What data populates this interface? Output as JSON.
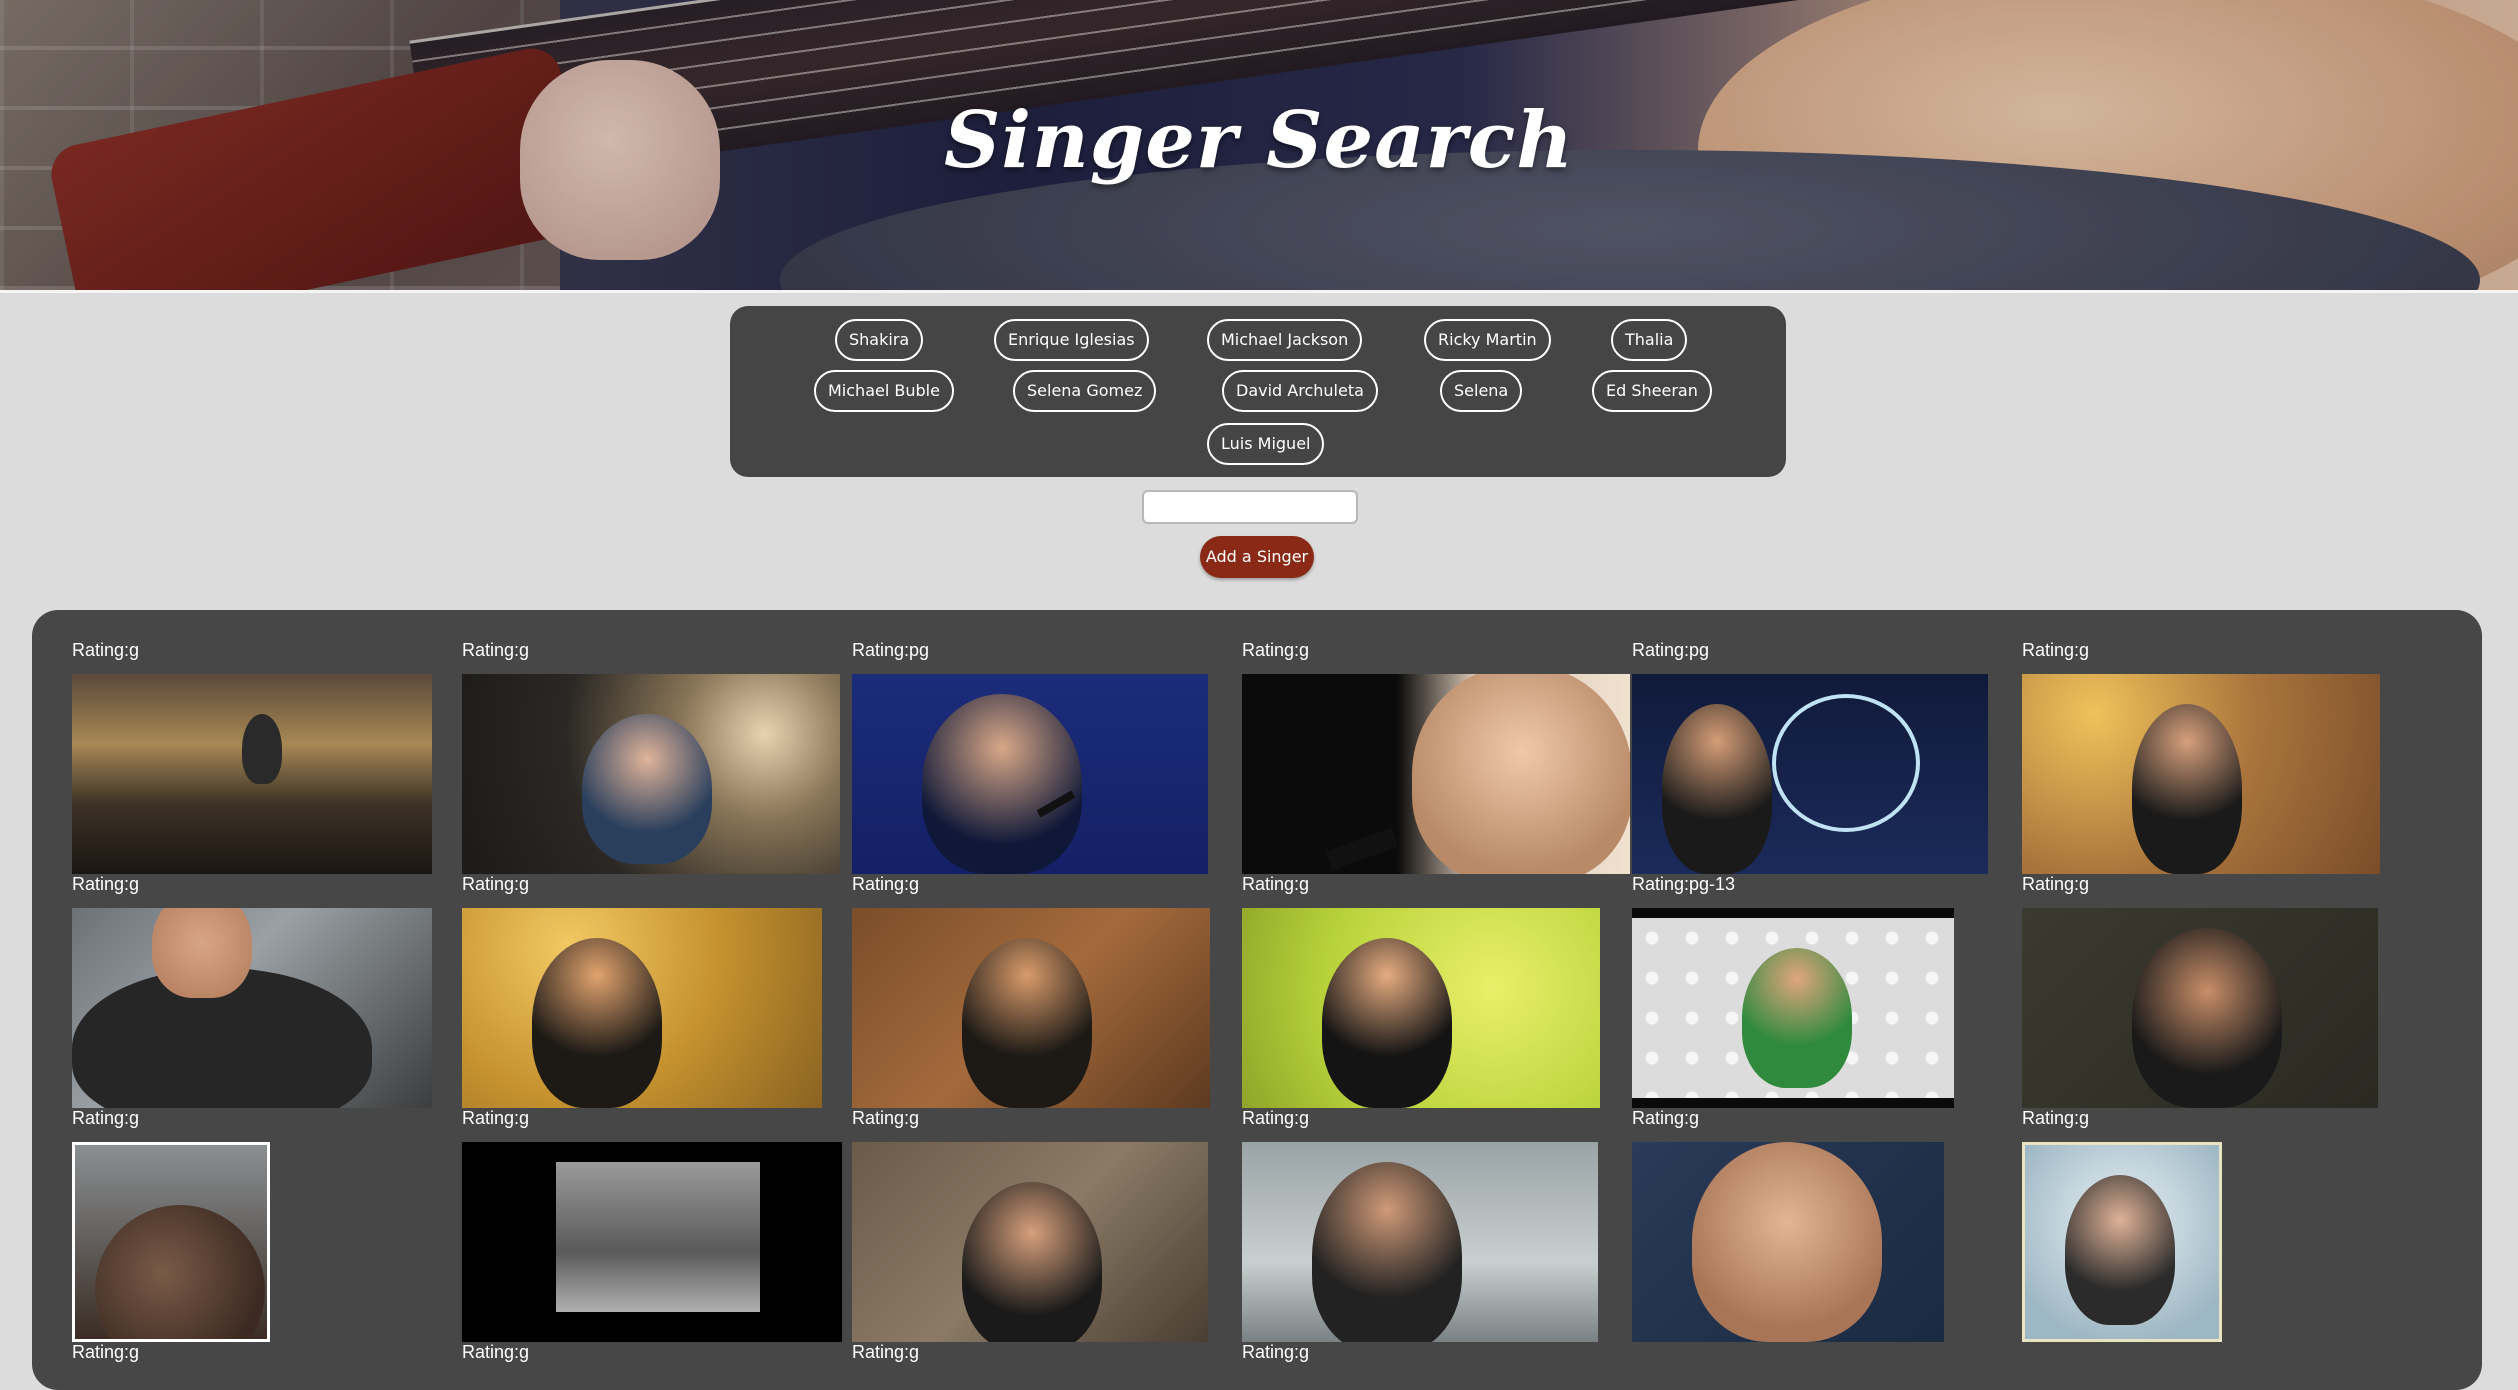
{
  "header": {
    "title": "Singer Search"
  },
  "singer_buttons": [
    {
      "label": "Shakira"
    },
    {
      "label": "Enrique Iglesias"
    },
    {
      "label": "Michael Jackson"
    },
    {
      "label": "Ricky Martin"
    },
    {
      "label": "Thalia"
    },
    {
      "label": "Michael Buble"
    },
    {
      "label": "Selena Gomez"
    },
    {
      "label": "David Archuleta"
    },
    {
      "label": "Selena"
    },
    {
      "label": "Ed Sheeran"
    },
    {
      "label": "Luis Miguel"
    }
  ],
  "search": {
    "value": "",
    "add_label": "Add a Singer"
  },
  "gifs": [
    {
      "rating": "Rating:g"
    },
    {
      "rating": "Rating:g"
    },
    {
      "rating": "Rating:pg"
    },
    {
      "rating": "Rating:g"
    },
    {
      "rating": "Rating:pg"
    },
    {
      "rating": "Rating:g"
    },
    {
      "rating": "Rating:g"
    },
    {
      "rating": "Rating:g"
    },
    {
      "rating": "Rating:g"
    },
    {
      "rating": "Rating:g"
    },
    {
      "rating": "Rating:pg-13"
    },
    {
      "rating": "Rating:g"
    },
    {
      "rating": "Rating:g"
    },
    {
      "rating": "Rating:g"
    },
    {
      "rating": "Rating:g"
    },
    {
      "rating": "Rating:g"
    },
    {
      "rating": "Rating:g"
    },
    {
      "rating": "Rating:g"
    },
    {
      "rating": "Rating:g"
    },
    {
      "rating": "Rating:g"
    },
    {
      "rating": "Rating:g"
    },
    {
      "rating": "Rating:g"
    }
  ],
  "colors": {
    "page_bg": "#dcdcdc",
    "panel_bg": "#454545",
    "add_button": "#8a2a16",
    "text": "#ffffff"
  }
}
